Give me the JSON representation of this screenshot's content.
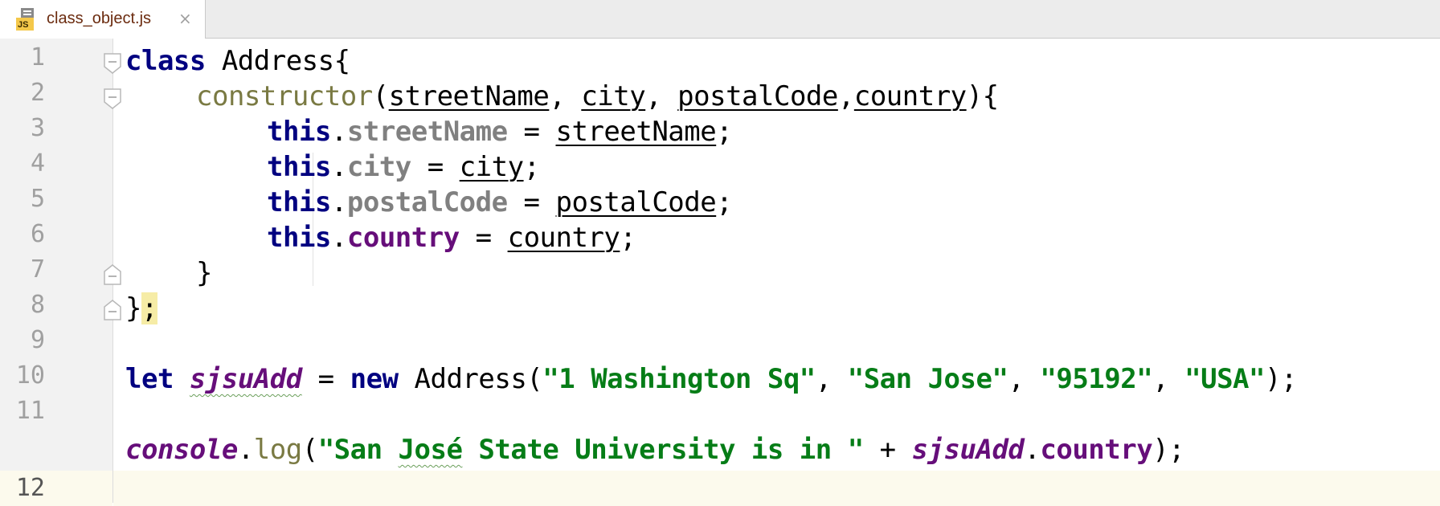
{
  "tab": {
    "icon_label": "JS",
    "filename": "class_object.js",
    "close_glyph": "×"
  },
  "line_numbers": [
    "1",
    "2",
    "3",
    "4",
    "5",
    "6",
    "7",
    "8",
    "9",
    "10",
    "11",
    "12"
  ],
  "code": {
    "l1": [
      "class",
      " Address{"
    ],
    "l2": [
      "constructor",
      "(",
      "streetName",
      ", ",
      "city",
      ", ",
      "postalCode",
      ",",
      "country",
      "){"
    ],
    "l3": [
      "this",
      ".",
      "streetName",
      " = ",
      "streetName",
      ";"
    ],
    "l4": [
      "this",
      ".",
      "city",
      " = ",
      "city",
      ";"
    ],
    "l5": [
      "this",
      ".",
      "postalCode",
      " = ",
      "postalCode",
      ";"
    ],
    "l6": [
      "this",
      ".",
      "country",
      " = ",
      "country",
      ";"
    ],
    "l7": [
      "}"
    ],
    "l8": [
      "}",
      ";"
    ],
    "l10": [
      "let",
      " ",
      "sjsuAdd",
      " = ",
      "new",
      " Address(",
      "\"1 Washington Sq\"",
      ", ",
      "\"San Jose\"",
      ", ",
      "\"95192\"",
      ", ",
      "\"USA\"",
      ");"
    ],
    "l12": [
      "console",
      ".",
      "log",
      "(",
      "\"San ",
      "José",
      " State University is in \"",
      " + ",
      "sjsuAdd",
      ".",
      "country",
      ");"
    ]
  },
  "colors": {
    "keyword": "#000080",
    "string": "#067d17",
    "property": "#660e7a",
    "field": "#808080",
    "function": "#7a7a43",
    "current_line": "#fcfaed"
  }
}
